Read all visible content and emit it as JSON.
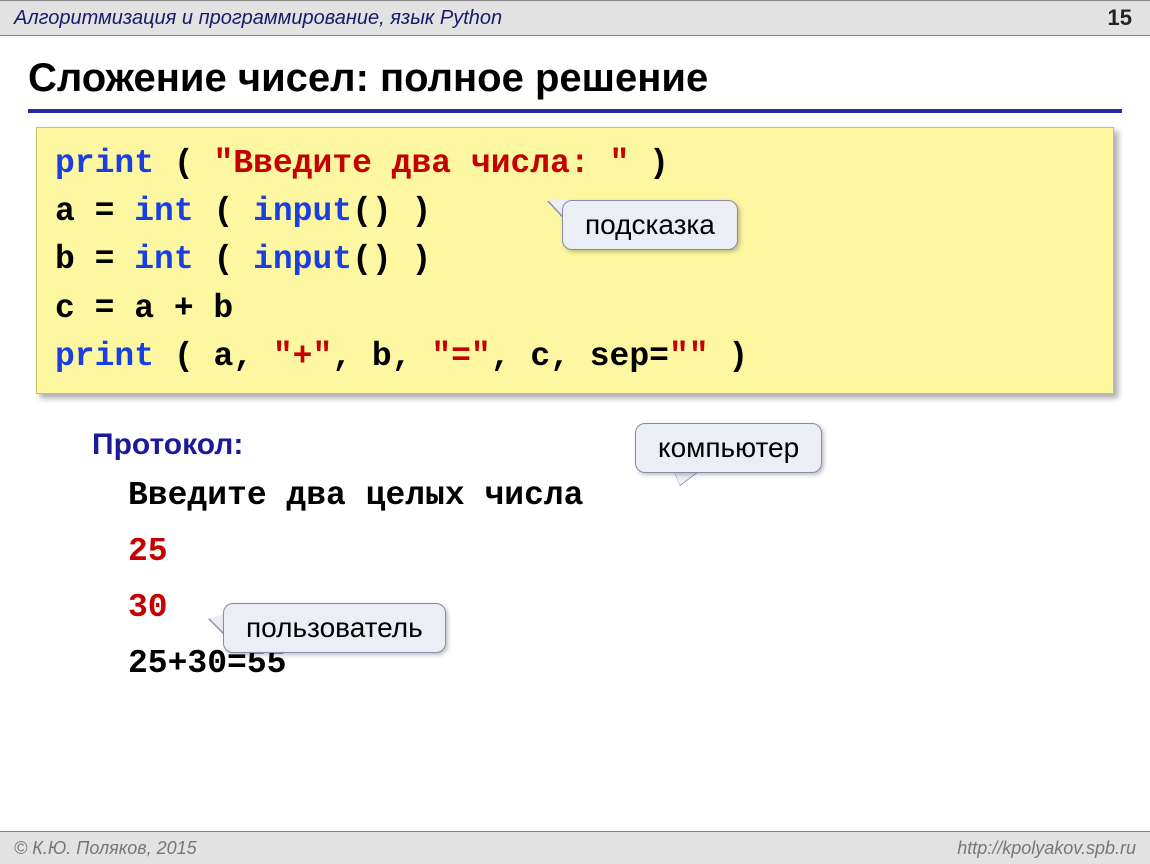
{
  "header": {
    "title": "Алгоритмизация и программирование,  язык Python",
    "page": "15"
  },
  "title": "Сложение чисел: полное решение",
  "code": {
    "l1": {
      "print": "print",
      "open": " ( ",
      "str": "\"Введите два числа: \"",
      "close": " )"
    },
    "l2": {
      "a": "a = ",
      "int": "int",
      "b": " ( ",
      "input": "input",
      "c": "() )"
    },
    "l3": {
      "a": "b = ",
      "int": "int",
      "b": " ( ",
      "input": "input",
      "c": "() )"
    },
    "l4": "c = a + b",
    "l5": {
      "print": "print",
      "a": " ( a, ",
      "s1": "\"+\"",
      "b": ", b, ",
      "s2": "\"=\"",
      "c": ", c, sep=",
      "s3": "\"\"",
      "d": " )"
    }
  },
  "callouts": {
    "hint": "подсказка",
    "computer": "компьютер",
    "user": "пользователь"
  },
  "protocol": {
    "label": "Протокол:",
    "prompt": "Введите два целых числа",
    "in1": "25",
    "in2": "30",
    "result": "25+30=55"
  },
  "footer": {
    "left": "© К.Ю. Поляков, 2015",
    "right": "http://kpolyakov.spb.ru"
  }
}
